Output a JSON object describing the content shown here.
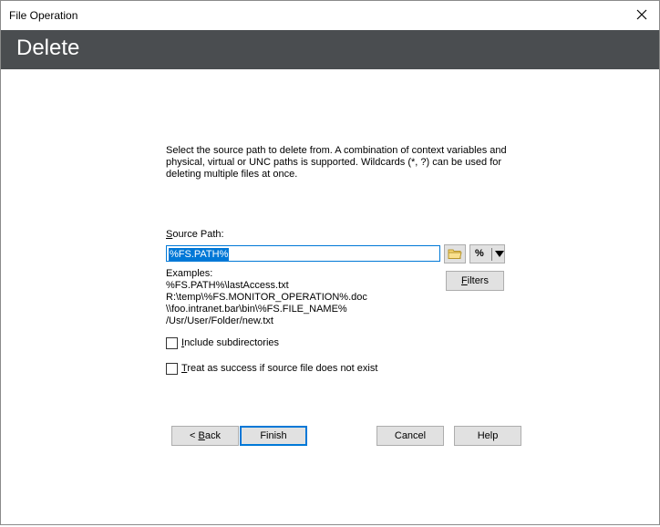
{
  "window": {
    "title": "File Operation",
    "heading": "Delete"
  },
  "description": "Select the source path to delete from. A combination of context variables and physical, virtual or UNC paths is supported. Wildcards (*, ?) can be used for deleting multiple files at once.",
  "source_path": {
    "label_mnemonic": "S",
    "label_rest": "ource Path:",
    "value": "%FS.PATH%",
    "var_button": "%"
  },
  "examples": {
    "title": "Examples:",
    "lines": [
      "%FS.PATH%\\lastAccess.txt",
      "R:\\temp\\%FS.MONITOR_OPERATION%.doc",
      "\\\\foo.intranet.bar\\bin\\%FS.FILE_NAME%",
      "/Usr/User/Folder/new.txt"
    ]
  },
  "filters_button": {
    "mnemonic": "F",
    "rest": "ilters"
  },
  "options": {
    "include_subdirs": {
      "mnemonic": "I",
      "rest": "nclude subdirectories",
      "checked": false
    },
    "treat_success": {
      "mnemonic": "T",
      "rest": "reat as success if source file does not exist",
      "checked": false
    }
  },
  "buttons": {
    "back": {
      "prefix": "< ",
      "mnemonic": "B",
      "rest": "ack"
    },
    "finish": "Finish",
    "cancel": "Cancel",
    "help": "Help"
  }
}
